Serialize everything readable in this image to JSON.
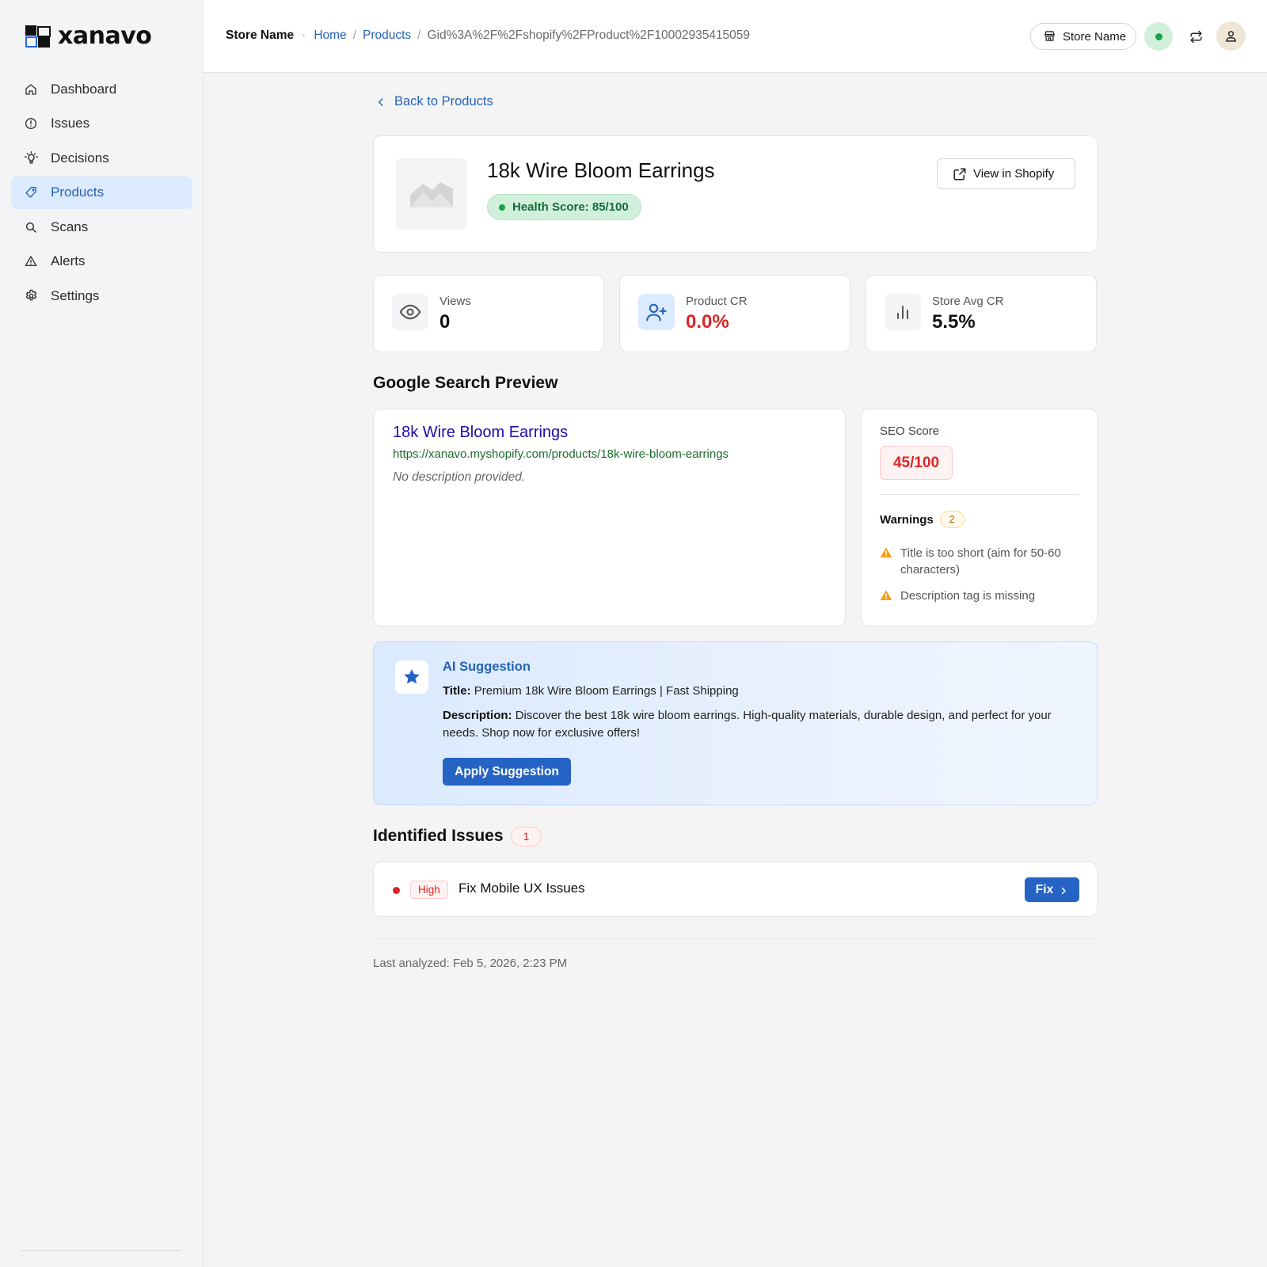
{
  "brand": {
    "name": "xanavo"
  },
  "sidebar": {
    "items": [
      {
        "label": "Dashboard",
        "icon": "home-icon"
      },
      {
        "label": "Issues",
        "icon": "alert-circle-icon"
      },
      {
        "label": "Decisions",
        "icon": "lightbulb-icon"
      },
      {
        "label": "Products",
        "icon": "tag-icon",
        "active": true
      },
      {
        "label": "Scans",
        "icon": "search-icon"
      },
      {
        "label": "Alerts",
        "icon": "warning-triangle-icon"
      },
      {
        "label": "Settings",
        "icon": "gear-icon"
      }
    ]
  },
  "topbar": {
    "store_name": "Store Name",
    "breadcrumb": [
      "Home",
      "Products",
      "Gid%3A%2F%2Fshopify%2FProduct%2F10002935415059"
    ],
    "store_pill_label": "Store Name"
  },
  "back_link": "Back to Products",
  "product": {
    "title": "18k Wire Bloom Earrings",
    "health_score": "Health Score: 85/100",
    "view_button": "View in Shopify"
  },
  "stats": [
    {
      "label": "Views",
      "value": "0",
      "icon": "eye-icon"
    },
    {
      "label": "Product CR",
      "value": "0.0%",
      "icon": "user-plus-icon"
    },
    {
      "label": "Store Avg CR",
      "value": "5.5%",
      "icon": "bar-chart-icon"
    }
  ],
  "search_preview": {
    "heading": "Google Search Preview",
    "title": "18k Wire Bloom Earrings",
    "url": "https://xanavo.myshopify.com/products/18k-wire-bloom-earrings",
    "description": "No description provided."
  },
  "seo": {
    "label": "SEO Score",
    "score": "45/100",
    "warnings_label": "Warnings",
    "warnings_count": "2",
    "warnings": [
      "Title is too short (aim for 50-60 characters)",
      "Description tag is missing"
    ]
  },
  "ai_suggestion": {
    "heading": "AI Suggestion",
    "title_label": "Title:",
    "title_value": "Premium 18k Wire Bloom Earrings | Fast Shipping",
    "description_label": "Description:",
    "description_value": "Discover the best 18k wire bloom earrings. High-quality materials, durable design, and perfect for your needs. Shop now for exclusive offers!",
    "button": "Apply Suggestion"
  },
  "issues": {
    "heading": "Identified Issues",
    "count": "1",
    "items": [
      {
        "severity": "High",
        "name": "Fix Mobile UX Issues",
        "action": "Fix"
      }
    ]
  },
  "last_analyzed": "Last analyzed: Feb 5, 2026, 2:23 PM",
  "colors": {
    "accent": "#2563b8",
    "danger": "#dc2626",
    "success": "#16a34a",
    "warning": "#f59e0b"
  }
}
